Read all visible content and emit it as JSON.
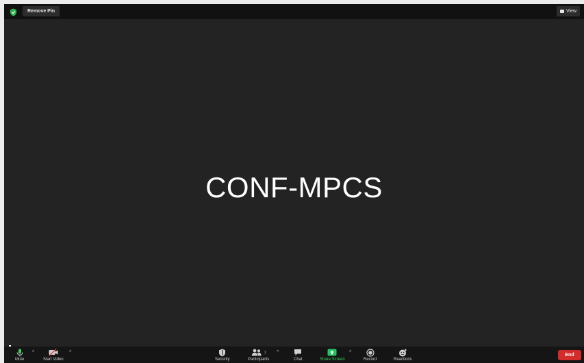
{
  "topbar": {
    "remove_pin_label": "Remove Pin",
    "view_label": "View"
  },
  "stage": {
    "meeting_name": "CONF-MPCS"
  },
  "toolbar": {
    "mute_label": "Mute",
    "start_video_label": "Start Video",
    "security_label": "Security",
    "participants_label": "Participants",
    "participants_count": "1",
    "chat_label": "Chat",
    "share_screen_label": "Share Screen",
    "record_label": "Record",
    "reactions_label": "Reactions",
    "end_label": "End"
  },
  "colors": {
    "shield_green": "#2fb14b",
    "share_green": "#22c55e",
    "end_red": "#d42b2b",
    "stage_bg": "#232323",
    "toolbar_bg": "#151515"
  },
  "icons": {
    "shield": "shield-icon",
    "view": "grid-view-icon",
    "mute": "microphone-icon",
    "start_video": "video-off-icon",
    "security": "shield-icon",
    "participants": "people-icon",
    "chat": "chat-bubble-icon",
    "share_screen": "share-screen-icon",
    "record": "record-icon",
    "reactions": "emoji-add-icon"
  }
}
